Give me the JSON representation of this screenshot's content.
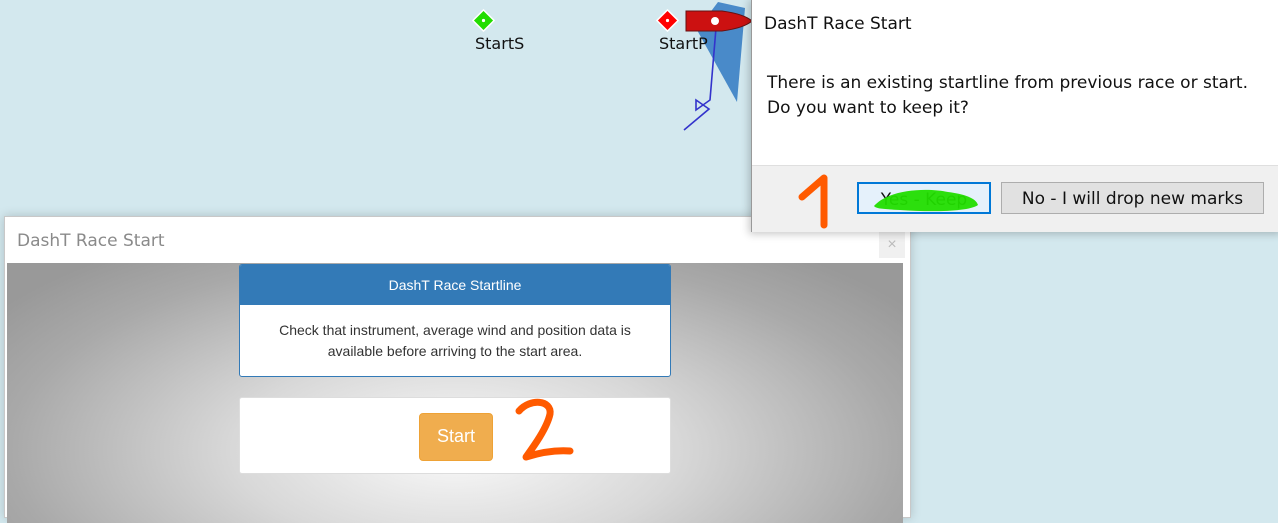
{
  "chart_marks": {
    "starboard_label": "StartS",
    "port_label": "StartP",
    "starboard_color": "#22dd00",
    "port_color": "#ff0000",
    "boat_color": "#cc1111",
    "laylines_color": "#3a7fc4",
    "wind_arrow_color": "#3333cc"
  },
  "plugin_window": {
    "title": "DashT Race Start",
    "close_glyph": "×",
    "panel_heading": "DashT Race Startline",
    "panel_text": "Check that instrument, average wind and position data is available before arriving to the start area.",
    "start_label": "Start",
    "heading_color": "#337ab7",
    "start_color": "#f0ad4e"
  },
  "dialog": {
    "title": "DashT Race Start",
    "message_line1": "There is an existing startline from previous race or start.",
    "message_line2": "Do you want to keep it?",
    "yes_label": "Yes - Keep",
    "no_label": "No - I will drop new marks"
  },
  "annotations": {
    "step1": "1",
    "step2": "2",
    "number_color": "#ff5a00",
    "highlight_color": "#22dd00"
  }
}
